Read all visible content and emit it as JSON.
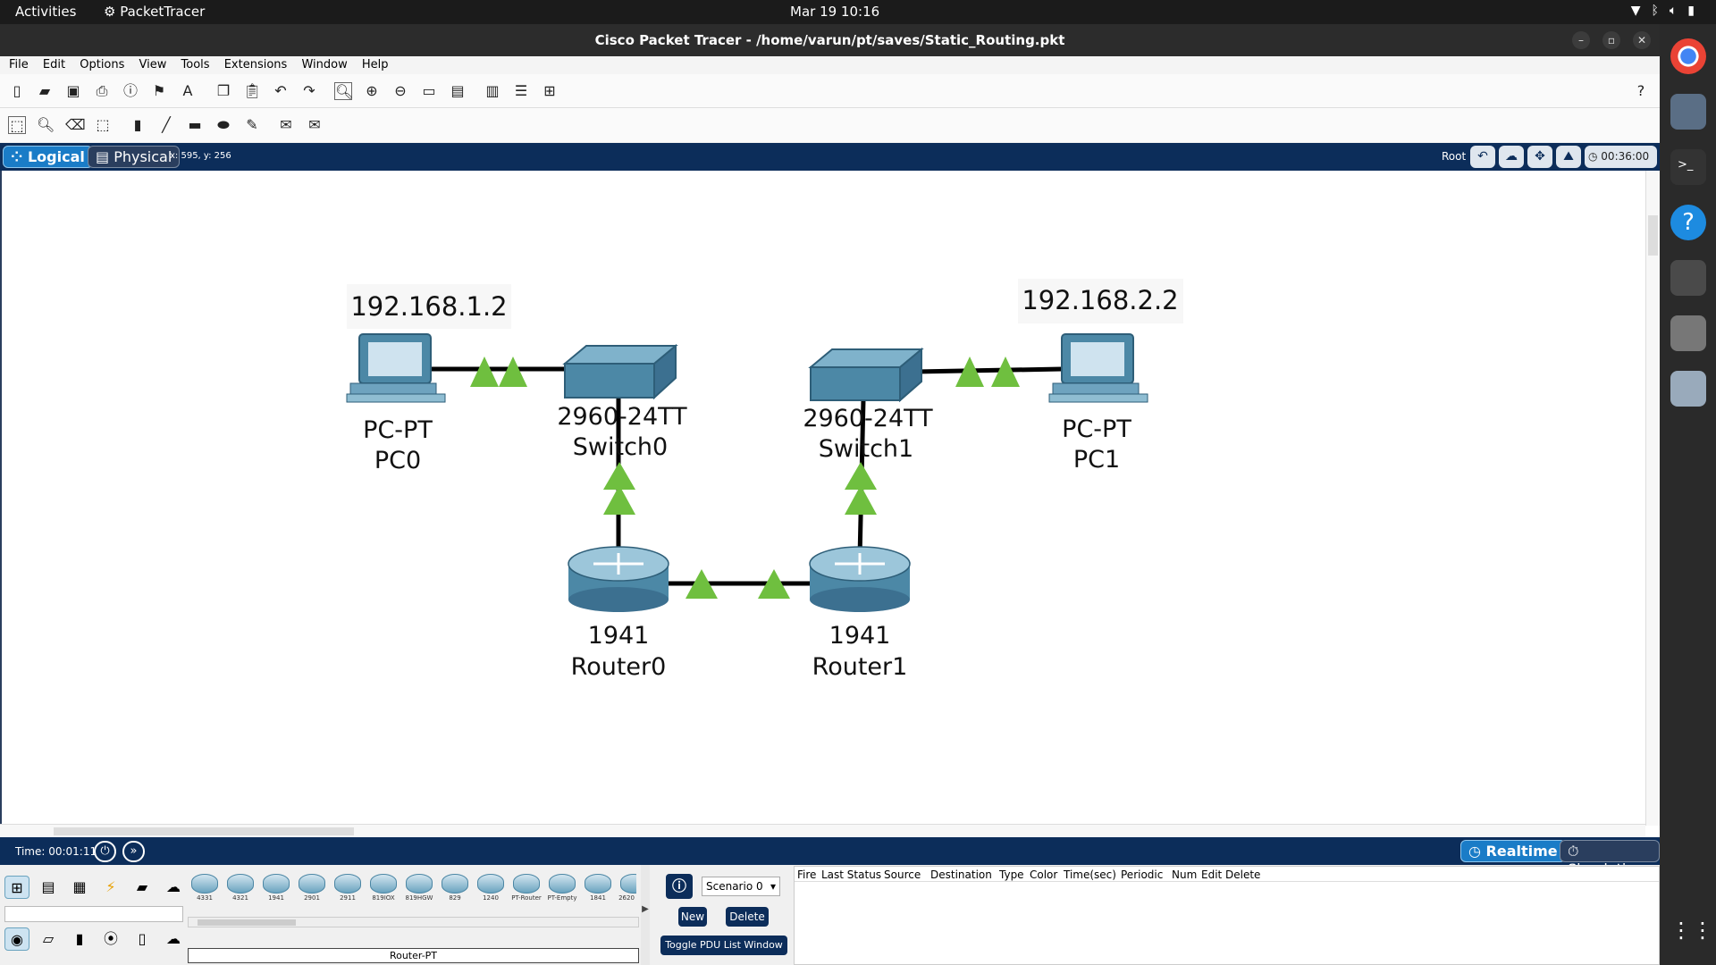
{
  "system": {
    "activities": "Activities",
    "app_name": "PacketTracer",
    "datetime": "Mar 19  10:16"
  },
  "window": {
    "title": "Cisco Packet Tracer - /home/varun/pt/saves/Static_Routing.pkt"
  },
  "menu": [
    "File",
    "Edit",
    "Options",
    "View",
    "Tools",
    "Extensions",
    "Window",
    "Help"
  ],
  "nav": {
    "logical": "Logical",
    "physical": "Physical",
    "coords": "x: 595, y: 256",
    "root": "Root",
    "timer": "00:36:00"
  },
  "topology": {
    "devices": [
      {
        "id": "pc0",
        "model": "PC-PT",
        "name": "PC0",
        "ip": "192.168.1.2"
      },
      {
        "id": "sw0",
        "model": "2960-24TT",
        "name": "Switch0"
      },
      {
        "id": "sw1",
        "model": "2960-24TT",
        "name": "Switch1"
      },
      {
        "id": "pc1",
        "model": "PC-PT",
        "name": "PC1",
        "ip": "192.168.2.2"
      },
      {
        "id": "r0",
        "model": "1941",
        "name": "Router0"
      },
      {
        "id": "r1",
        "model": "1941",
        "name": "Router1"
      }
    ],
    "link_status_color": "#6fbf3f"
  },
  "bottom": {
    "time": "Time: 00:01:11",
    "realtime": "Realtime",
    "simulation": "Simulation"
  },
  "devices_panel": {
    "models": [
      "4331",
      "4321",
      "1941",
      "2901",
      "2911",
      "819IOX",
      "819HGW",
      "829",
      "1240",
      "PT-Router",
      "PT-Empty",
      "1841",
      "2620"
    ],
    "selected_device": "Router-PT"
  },
  "pdu": {
    "scenario": "Scenario 0",
    "new_label": "New",
    "delete_label": "Delete",
    "toggle_label": "Toggle PDU List Window",
    "columns": [
      "Fire",
      "Last Status",
      "Source",
      "Destination",
      "Type",
      "Color",
      "Time(sec)",
      "Periodic",
      "Num",
      "Edit",
      "Delete"
    ]
  }
}
